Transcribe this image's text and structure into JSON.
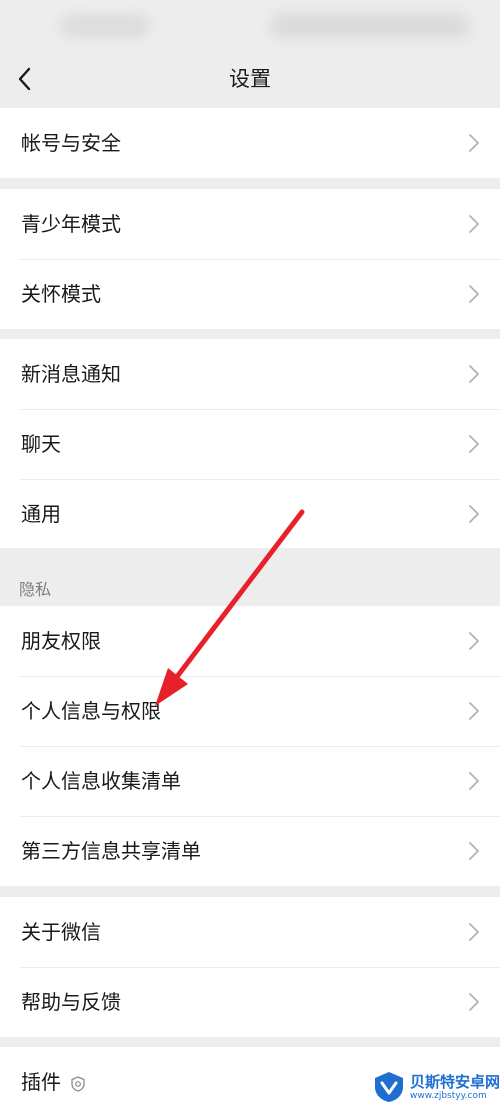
{
  "nav": {
    "title": "设置"
  },
  "groups": [
    {
      "items": [
        {
          "label": "帐号与安全"
        }
      ]
    },
    {
      "items": [
        {
          "label": "青少年模式"
        },
        {
          "label": "关怀模式"
        }
      ]
    },
    {
      "items": [
        {
          "label": "新消息通知"
        },
        {
          "label": "聊天"
        },
        {
          "label": "通用"
        }
      ]
    },
    {
      "header": "隐私",
      "items": [
        {
          "label": "朋友权限"
        },
        {
          "label": "个人信息与权限"
        },
        {
          "label": "个人信息收集清单"
        },
        {
          "label": "第三方信息共享清单"
        }
      ]
    },
    {
      "items": [
        {
          "label": "关于微信"
        },
        {
          "label": "帮助与反馈"
        }
      ]
    },
    {
      "items": [
        {
          "label": "插件"
        }
      ]
    }
  ],
  "watermark": {
    "name": "贝斯特安卓网",
    "url": "www.zjbstyy.com"
  },
  "icons": {
    "back": "chevron-left-icon",
    "row": "chevron-right-icon",
    "plugin": "plugin-shield-icon",
    "annotation": "red-arrow"
  },
  "colors": {
    "background": "#ededed",
    "row_background": "#ffffff",
    "text": "#191919",
    "section_header_text": "#7f7f7f",
    "chevron": "#b2b2b2",
    "annotation_arrow": "#e8202a",
    "watermark": "#1f6fd1"
  }
}
